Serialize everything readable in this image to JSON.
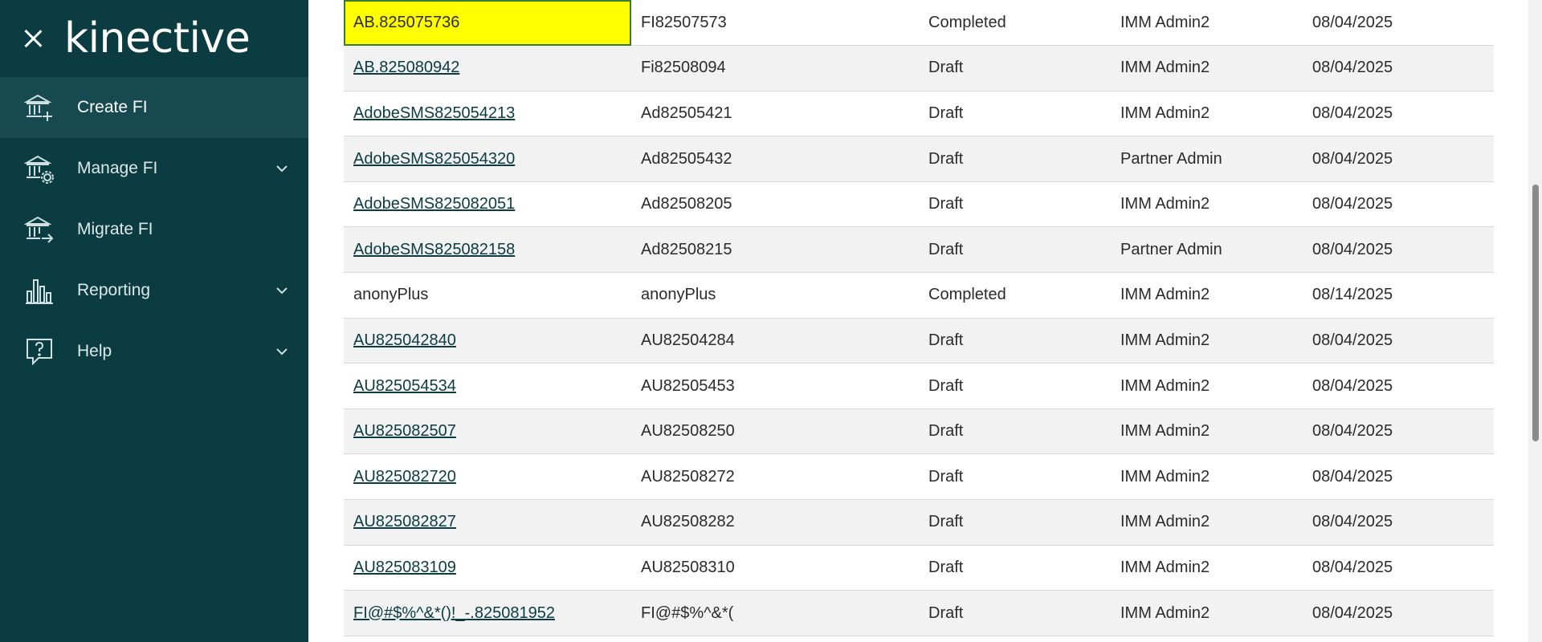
{
  "sidebar": {
    "logo": "kinective",
    "nav": [
      {
        "label": "Create FI",
        "icon": "bank-add-icon",
        "expandable": false,
        "active": true
      },
      {
        "label": "Manage FI",
        "icon": "bank-settings-icon",
        "expandable": true
      },
      {
        "label": "Migrate FI",
        "icon": "bank-migrate-icon",
        "expandable": true
      },
      {
        "label": "Reporting",
        "icon": "bar-chart-icon",
        "expandable": true
      },
      {
        "label": "Help",
        "icon": "help-bubble-icon",
        "expandable": true
      }
    ]
  },
  "table": {
    "rows": [
      {
        "name": "AB.825075736",
        "code": "FI82507573",
        "status": "Completed",
        "user": "IMM Admin2",
        "date": "08/04/2025",
        "link": false,
        "highlight": true
      },
      {
        "name": "AB.825080942",
        "code": "Fi82508094",
        "status": "Draft",
        "user": "IMM Admin2",
        "date": "08/04/2025",
        "link": true
      },
      {
        "name": "AdobeSMS825054213",
        "code": "Ad82505421",
        "status": "Draft",
        "user": "IMM Admin2",
        "date": "08/04/2025",
        "link": true
      },
      {
        "name": "AdobeSMS825054320",
        "code": "Ad82505432",
        "status": "Draft",
        "user": "Partner Admin",
        "date": "08/04/2025",
        "link": true
      },
      {
        "name": "AdobeSMS825082051",
        "code": "Ad82508205",
        "status": "Draft",
        "user": "IMM Admin2",
        "date": "08/04/2025",
        "link": true
      },
      {
        "name": "AdobeSMS825082158",
        "code": "Ad82508215",
        "status": "Draft",
        "user": "Partner Admin",
        "date": "08/04/2025",
        "link": true
      },
      {
        "name": "anonyPlus",
        "code": "anonyPlus",
        "status": "Completed",
        "user": "IMM Admin2",
        "date": "08/14/2025",
        "link": false
      },
      {
        "name": "AU825042840",
        "code": "AU82504284",
        "status": "Draft",
        "user": "IMM Admin2",
        "date": "08/04/2025",
        "link": true
      },
      {
        "name": "AU825054534",
        "code": "AU82505453",
        "status": "Draft",
        "user": "IMM Admin2",
        "date": "08/04/2025",
        "link": true
      },
      {
        "name": "AU825082507",
        "code": "AU82508250",
        "status": "Draft",
        "user": "IMM Admin2",
        "date": "08/04/2025",
        "link": true
      },
      {
        "name": "AU825082720",
        "code": "AU82508272",
        "status": "Draft",
        "user": "IMM Admin2",
        "date": "08/04/2025",
        "link": true
      },
      {
        "name": "AU825082827",
        "code": "AU82508282",
        "status": "Draft",
        "user": "IMM Admin2",
        "date": "08/04/2025",
        "link": true
      },
      {
        "name": "AU825083109",
        "code": "AU82508310",
        "status": "Draft",
        "user": "IMM Admin2",
        "date": "08/04/2025",
        "link": true
      },
      {
        "name": "FI@#$%^&*()!_-.825081952",
        "code": "FI@#$%^&*(",
        "status": "Draft",
        "user": "IMM Admin2",
        "date": "08/04/2025",
        "link": true
      }
    ]
  }
}
